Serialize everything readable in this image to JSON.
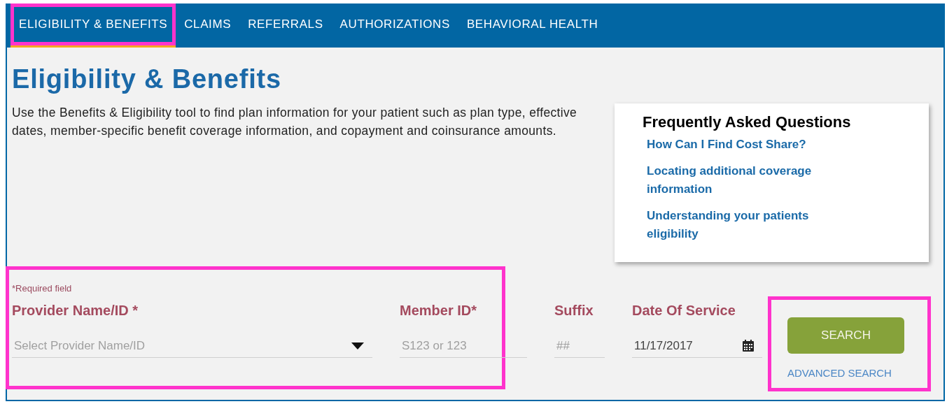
{
  "nav": {
    "tabs": [
      {
        "label": "ELIGIBILITY & BENEFITS",
        "selected": true,
        "highlighted": true
      },
      {
        "label": "CLAIMS",
        "selected": false,
        "highlighted": false
      },
      {
        "label": "REFERRALS",
        "selected": false,
        "highlighted": false
      },
      {
        "label": "AUTHORIZATIONS",
        "selected": false,
        "highlighted": false
      },
      {
        "label": "BEHAVIORAL HEALTH",
        "selected": false,
        "highlighted": false
      }
    ]
  },
  "page": {
    "title": "Eligibility & Benefits",
    "description": "Use the Benefits & Eligibility tool to find plan information for your patient such as plan type, effective dates, member-specific benefit coverage information, and copayment and coinsurance amounts."
  },
  "faq": {
    "title": "Frequently Asked Questions",
    "links": [
      "How Can I Find Cost Share?",
      "Locating additional coverage information",
      "Understanding your patients eligibility"
    ]
  },
  "form": {
    "required_note": "*Required field",
    "highlighted": true,
    "fields": [
      {
        "kind": "select",
        "label": "Provider Name/ID *",
        "placeholder": "Select Provider Name/ID"
      },
      {
        "kind": "text",
        "label": "Member ID*",
        "placeholder": "S123 or 123"
      },
      {
        "kind": "text",
        "label": "Suffix",
        "placeholder": "##"
      },
      {
        "kind": "date",
        "label": "Date Of Service",
        "value": "11/17/2017"
      }
    ]
  },
  "actions": {
    "highlighted": true,
    "search_button": "SEARCH",
    "advanced_search_link": "ADVANCED SEARCH"
  }
}
